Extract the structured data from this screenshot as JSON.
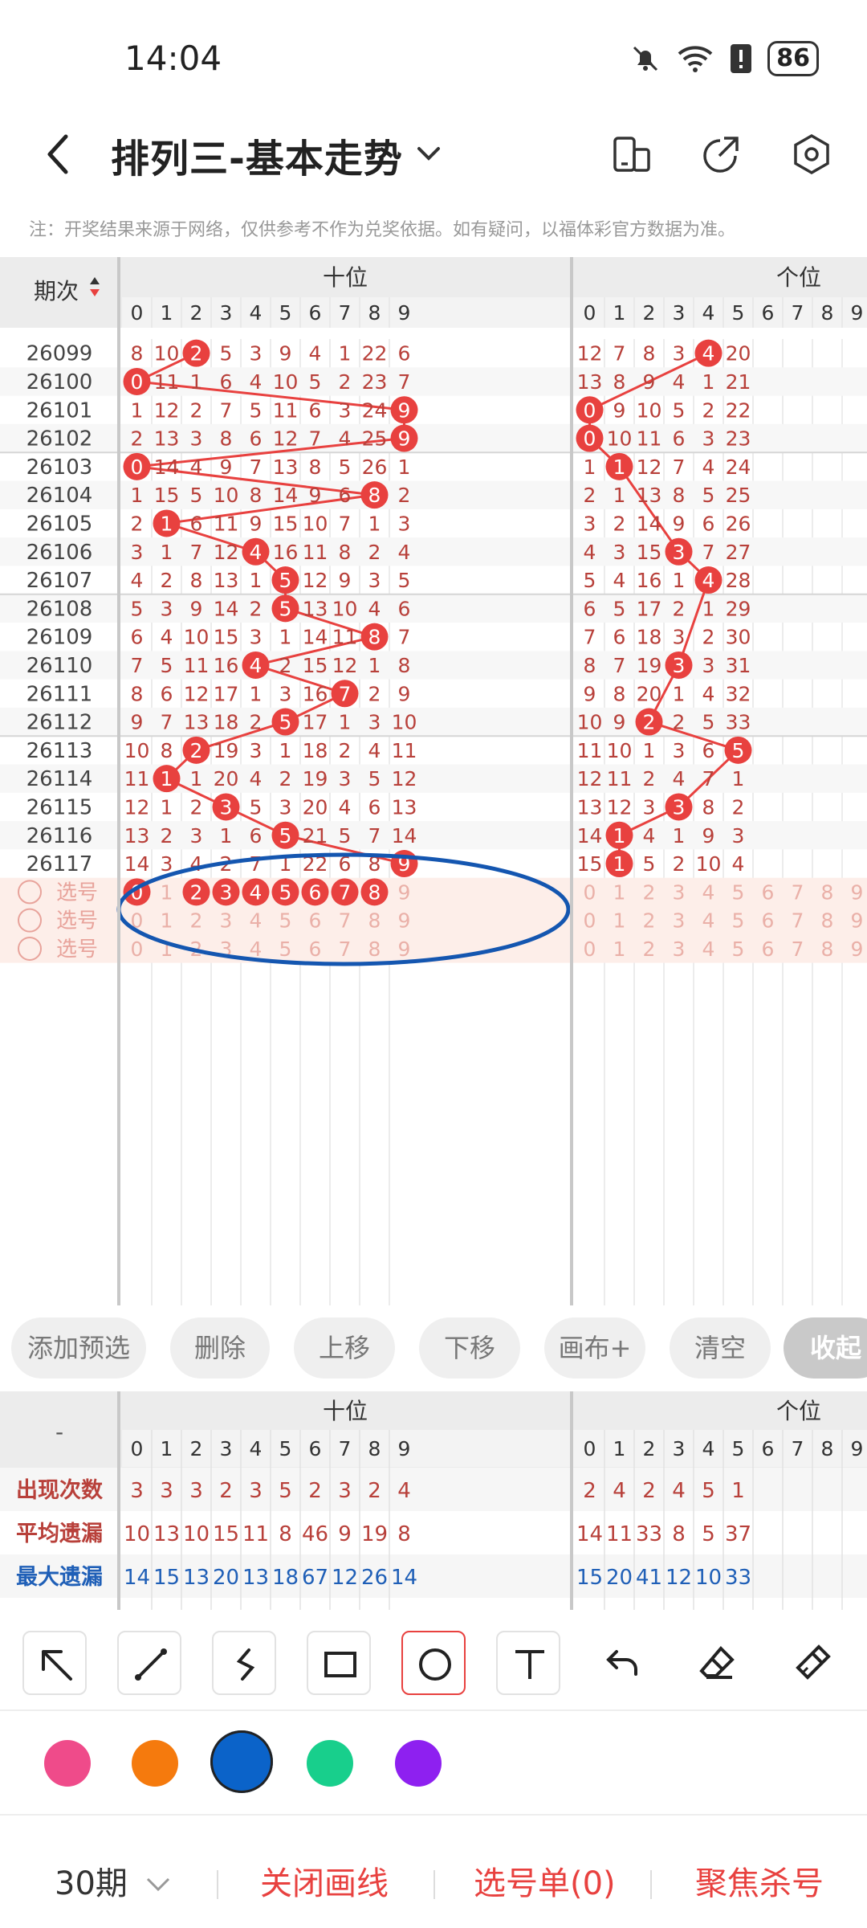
{
  "status_bar": {
    "time": "14:04",
    "battery": "86"
  },
  "app_bar": {
    "title": "排列三-基本走势"
  },
  "notice": "注：开奖结果来源于网络，仅供参考不作为兑奖依据。如有疑问，以福体彩官方数据为准。",
  "chart": {
    "period_header": "期次",
    "groups": [
      "十位",
      "个位"
    ],
    "digit_headers": [
      "0",
      "1",
      "2",
      "3",
      "4",
      "5",
      "6",
      "7",
      "8",
      "9"
    ],
    "rows": [
      {
        "period": "26099",
        "ten": [
          "8",
          "10",
          "2",
          "5",
          "3",
          "9",
          "4",
          "1",
          "22",
          "6"
        ],
        "unit": [
          "12",
          "7",
          "8",
          "3",
          "4",
          "20"
        ],
        "ten_hit": 2,
        "unit_hit": 4
      },
      {
        "period": "26100",
        "ten": [
          "0",
          "11",
          "1",
          "6",
          "4",
          "10",
          "5",
          "2",
          "23",
          "7"
        ],
        "unit": [
          "13",
          "8",
          "9",
          "4",
          "1",
          "21"
        ],
        "ten_hit": 0,
        "unit_hit": -1
      },
      {
        "period": "26101",
        "ten": [
          "1",
          "12",
          "2",
          "7",
          "5",
          "11",
          "6",
          "3",
          "24",
          "9"
        ],
        "unit": [
          "0",
          "9",
          "10",
          "5",
          "2",
          "22"
        ],
        "ten_hit": 9,
        "unit_hit": 0
      },
      {
        "period": "26102",
        "ten": [
          "2",
          "13",
          "3",
          "8",
          "6",
          "12",
          "7",
          "4",
          "25",
          "9"
        ],
        "unit": [
          "0",
          "10",
          "11",
          "6",
          "3",
          "23"
        ],
        "ten_hit": 9,
        "unit_hit": 0
      },
      {
        "period": "26103",
        "ten": [
          "0",
          "14",
          "4",
          "9",
          "7",
          "13",
          "8",
          "5",
          "26",
          "1"
        ],
        "unit": [
          "1",
          "1",
          "12",
          "7",
          "4",
          "24"
        ],
        "ten_hit": 0,
        "unit_hit": 1
      },
      {
        "period": "26104",
        "ten": [
          "1",
          "15",
          "5",
          "10",
          "8",
          "14",
          "9",
          "6",
          "8",
          "2"
        ],
        "unit": [
          "2",
          "1",
          "13",
          "8",
          "5",
          "25"
        ],
        "ten_hit": 8,
        "unit_hit": -1
      },
      {
        "period": "26105",
        "ten": [
          "2",
          "1",
          "6",
          "11",
          "9",
          "15",
          "10",
          "7",
          "1",
          "3"
        ],
        "unit": [
          "3",
          "2",
          "14",
          "9",
          "6",
          "26"
        ],
        "ten_hit": 1,
        "unit_hit": -1
      },
      {
        "period": "26106",
        "ten": [
          "3",
          "1",
          "7",
          "12",
          "4",
          "16",
          "11",
          "8",
          "2",
          "4"
        ],
        "unit": [
          "4",
          "3",
          "15",
          "3",
          "7",
          "27"
        ],
        "ten_hit": 4,
        "unit_hit": 3
      },
      {
        "period": "26107",
        "ten": [
          "4",
          "2",
          "8",
          "13",
          "1",
          "5",
          "12",
          "9",
          "3",
          "5"
        ],
        "unit": [
          "5",
          "4",
          "16",
          "1",
          "4",
          "28"
        ],
        "ten_hit": 5,
        "unit_hit": 4
      },
      {
        "period": "26108",
        "ten": [
          "5",
          "3",
          "9",
          "14",
          "2",
          "5",
          "13",
          "10",
          "4",
          "6"
        ],
        "unit": [
          "6",
          "5",
          "17",
          "2",
          "1",
          "29"
        ],
        "ten_hit": 5,
        "unit_hit": -1
      },
      {
        "period": "26109",
        "ten": [
          "6",
          "4",
          "10",
          "15",
          "3",
          "1",
          "14",
          "11",
          "8",
          "7"
        ],
        "unit": [
          "7",
          "6",
          "18",
          "3",
          "2",
          "30"
        ],
        "ten_hit": 8,
        "unit_hit": -1
      },
      {
        "period": "26110",
        "ten": [
          "7",
          "5",
          "11",
          "16",
          "4",
          "2",
          "15",
          "12",
          "1",
          "8"
        ],
        "unit": [
          "8",
          "7",
          "19",
          "3",
          "3",
          "31"
        ],
        "ten_hit": 4,
        "unit_hit": 3
      },
      {
        "period": "26111",
        "ten": [
          "8",
          "6",
          "12",
          "17",
          "1",
          "3",
          "16",
          "7",
          "2",
          "9"
        ],
        "unit": [
          "9",
          "8",
          "20",
          "1",
          "4",
          "32"
        ],
        "ten_hit": 7,
        "unit_hit": -1
      },
      {
        "period": "26112",
        "ten": [
          "9",
          "7",
          "13",
          "18",
          "2",
          "5",
          "17",
          "1",
          "3",
          "10"
        ],
        "unit": [
          "10",
          "9",
          "2",
          "2",
          "5",
          "33"
        ],
        "ten_hit": 5,
        "unit_hit": 2
      },
      {
        "period": "26113",
        "ten": [
          "10",
          "8",
          "2",
          "19",
          "3",
          "1",
          "18",
          "2",
          "4",
          "11"
        ],
        "unit": [
          "11",
          "10",
          "1",
          "3",
          "6",
          "5"
        ],
        "ten_hit": 2,
        "unit_hit": 5
      },
      {
        "period": "26114",
        "ten": [
          "11",
          "1",
          "1",
          "20",
          "4",
          "2",
          "19",
          "3",
          "5",
          "12"
        ],
        "unit": [
          "12",
          "11",
          "2",
          "4",
          "7",
          "1"
        ],
        "ten_hit": 1,
        "unit_hit": -1
      },
      {
        "period": "26115",
        "ten": [
          "12",
          "1",
          "2",
          "3",
          "5",
          "3",
          "20",
          "4",
          "6",
          "13"
        ],
        "unit": [
          "13",
          "12",
          "3",
          "3",
          "8",
          "2"
        ],
        "ten_hit": 3,
        "unit_hit": 3
      },
      {
        "period": "26116",
        "ten": [
          "13",
          "2",
          "3",
          "1",
          "6",
          "5",
          "21",
          "5",
          "7",
          "14"
        ],
        "unit": [
          "14",
          "1",
          "4",
          "1",
          "9",
          "3"
        ],
        "ten_hit": 5,
        "unit_hit": 1
      },
      {
        "period": "26117",
        "ten": [
          "14",
          "3",
          "4",
          "2",
          "7",
          "1",
          "22",
          "6",
          "8",
          "9"
        ],
        "unit": [
          "15",
          "1",
          "5",
          "2",
          "10",
          "4"
        ],
        "ten_hit": 9,
        "unit_hit": 1
      }
    ],
    "select_label": "选号",
    "select_row1_selected": [
      0,
      2,
      3,
      4,
      5,
      6,
      7,
      8
    ]
  },
  "chips": [
    "添加预选",
    "删除",
    "上移",
    "下移",
    "画布+",
    "清空",
    "收起"
  ],
  "stats": {
    "corner": "-",
    "groups": [
      "十位",
      "个位"
    ],
    "rows": [
      {
        "label": "出现次数",
        "ten": [
          "3",
          "3",
          "3",
          "2",
          "3",
          "5",
          "2",
          "3",
          "2",
          "4"
        ],
        "unit": [
          "2",
          "4",
          "2",
          "4",
          "5",
          "1"
        ]
      },
      {
        "label": "平均遗漏",
        "ten": [
          "10",
          "13",
          "10",
          "15",
          "11",
          "8",
          "46",
          "9",
          "19",
          "8"
        ],
        "unit": [
          "14",
          "11",
          "33",
          "8",
          "5",
          "37"
        ]
      },
      {
        "label": "最大遗漏",
        "ten": [
          "14",
          "15",
          "13",
          "20",
          "13",
          "18",
          "67",
          "12",
          "26",
          "14"
        ],
        "unit": [
          "15",
          "20",
          "41",
          "12",
          "10",
          "33"
        ]
      }
    ]
  },
  "colors": {
    "accent_red": "#e8413f",
    "text_red": "#b8403a",
    "blue": "#1f5fb7",
    "ellipse": "#1456b0",
    "swatches": [
      "#ef4b8a",
      "#f57a0d",
      "#0b63c9",
      "#18cf8c",
      "#8e20f0"
    ]
  },
  "bottom_bar": {
    "period_select": "30期",
    "close_draw": "关闭画线",
    "select_list": "选号单(0)",
    "focus_kill": "聚焦杀号"
  }
}
